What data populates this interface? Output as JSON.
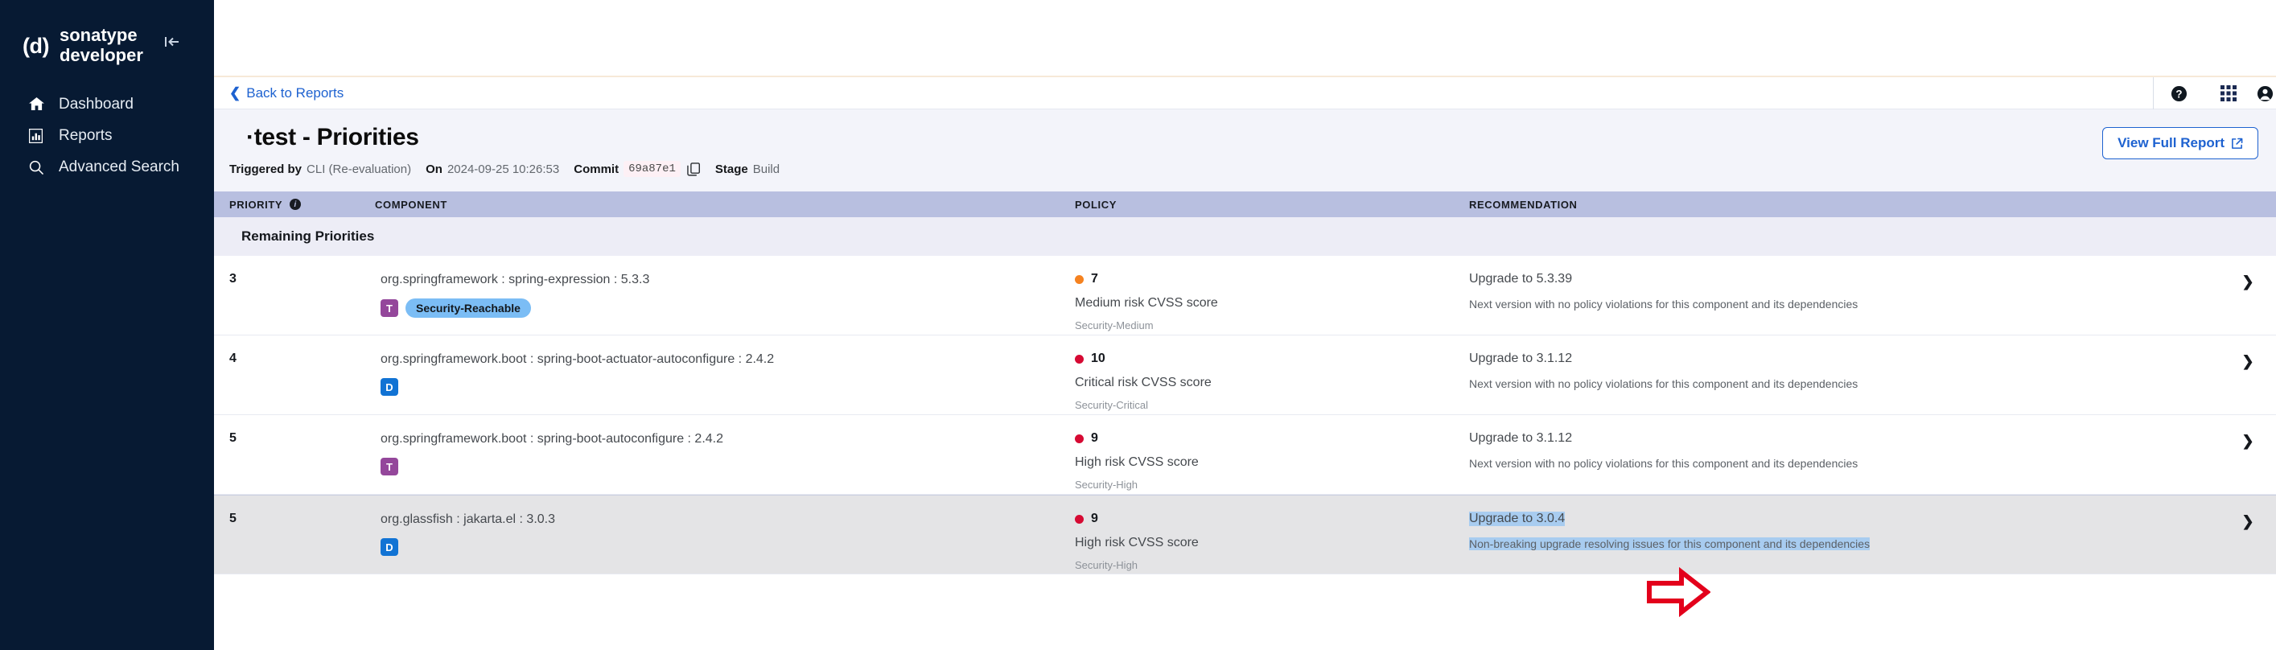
{
  "sidebar": {
    "brand_logo": "(d)",
    "brand_line1": "sonatype",
    "brand_line2": "developer",
    "collapse_label": "|←",
    "items": [
      {
        "label": "Dashboard",
        "icon": "home-icon"
      },
      {
        "label": "Reports",
        "icon": "chart-bar-icon"
      },
      {
        "label": "Advanced Search",
        "icon": "search-icon"
      }
    ]
  },
  "topbar": {
    "back_label": "Back to Reports",
    "back_chevron": "❮",
    "icons": [
      {
        "name": "help-icon",
        "glyph": "?"
      },
      {
        "name": "apps-grid-icon",
        "glyph": "grid"
      },
      {
        "name": "account-icon",
        "glyph": "user"
      }
    ]
  },
  "report": {
    "title": "·test - Priorities",
    "triggered_by_label": "Triggered by",
    "triggered_by_value": "CLI (Re-evaluation)",
    "on_label": "On",
    "on_value": "2024-09-25 10:26:53",
    "commit_label": "Commit",
    "commit_value": "69a87e1",
    "copy_icon": "copy-icon",
    "stage_label": "Stage",
    "stage_value": "Build",
    "view_full_report": "View Full Report",
    "external_link_icon": "external-link-icon"
  },
  "table": {
    "headers": {
      "priority": "PRIORITY",
      "component": "COMPONENT",
      "policy": "POLICY",
      "recommendation": "RECOMMENDATION"
    },
    "group_label": "Remaining Priorities",
    "rows": [
      {
        "priority": "3",
        "component": "org.springframework : spring-expression : 5.3.3",
        "badge": "T",
        "badge_type": "T",
        "pill": "Security-Reachable",
        "score": "7",
        "score_color": "#f58220",
        "policy_desc": "Medium risk CVSS score",
        "policy_tag": "Security-Medium",
        "rec_title": "Upgrade to 5.3.39",
        "rec_sub": "Next version with no policy violations for this component and its dependencies",
        "selected": false,
        "highlight": false
      },
      {
        "priority": "4",
        "component": "org.springframework.boot : spring-boot-actuator-autoconfigure : 2.4.2",
        "badge": "D",
        "badge_type": "D",
        "pill": "",
        "score": "10",
        "score_color": "#d60a33",
        "policy_desc": "Critical risk CVSS score",
        "policy_tag": "Security-Critical",
        "rec_title": "Upgrade to 3.1.12",
        "rec_sub": "Next version with no policy violations for this component and its dependencies",
        "selected": false,
        "highlight": false
      },
      {
        "priority": "5",
        "component": "org.springframework.boot : spring-boot-autoconfigure : 2.4.2",
        "badge": "T",
        "badge_type": "T",
        "pill": "",
        "score": "9",
        "score_color": "#d60a33",
        "policy_desc": "High risk CVSS score",
        "policy_tag": "Security-High",
        "rec_title": "Upgrade to 3.1.12",
        "rec_sub": "Next version with no policy violations for this component and its dependencies",
        "selected": false,
        "highlight": false
      },
      {
        "priority": "5",
        "component": "org.glassfish : jakarta.el : 3.0.3",
        "badge": "D",
        "badge_type": "D",
        "pill": "",
        "score": "9",
        "score_color": "#d60a33",
        "policy_desc": "High risk CVSS score",
        "policy_tag": "Security-High",
        "rec_title": "Upgrade to 3.0.4",
        "rec_sub": "Non-breaking upgrade resolving issues for this component and its dependencies",
        "selected": true,
        "highlight": true
      }
    ],
    "row_chevron": "❯"
  },
  "annotation": {
    "arrow_color": "#e3001b",
    "arrow_name": "red-pointer-arrow"
  }
}
